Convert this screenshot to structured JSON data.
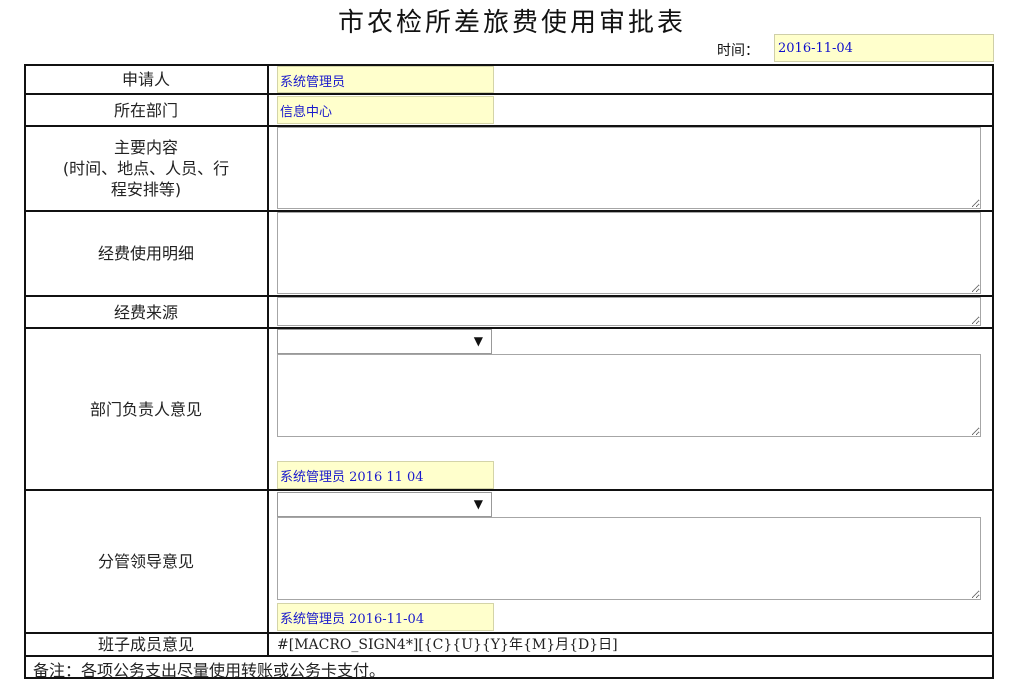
{
  "form": {
    "title": "市农检所差旅费使用审批表",
    "time_label": "时间：",
    "time_value": "2016-11-04"
  },
  "rows": {
    "applicant_label": "申请人",
    "applicant_value": "系统管理员",
    "department_label": "所在部门",
    "department_value": "信息中心",
    "content_label_line1": "主要内容",
    "content_label_line2": "(时间、地点、人员、行",
    "content_label_line3": "程安排等)",
    "content_value": "",
    "expense_detail_label": "经费使用明细",
    "expense_detail_value": "",
    "fund_source_label": "经费来源",
    "fund_source_value": "",
    "dept_head_label": "部门负责人意见",
    "dept_head_select": "",
    "dept_head_comment": "",
    "dept_head_signature": "系统管理员 2016 11 04",
    "leader_label": "分管领导意见",
    "leader_select": "",
    "leader_comment": "",
    "leader_signature": "系统管理员 2016-11-04",
    "team_label": "班子成员意见",
    "team_value": "#[MACRO_SIGN4*][{C}{U}{Y}年{M}月{D}日]"
  },
  "note": "备注：各项公务支出尽量使用转账或公务卡支付。",
  "icons": {
    "dropdown": "▼"
  }
}
